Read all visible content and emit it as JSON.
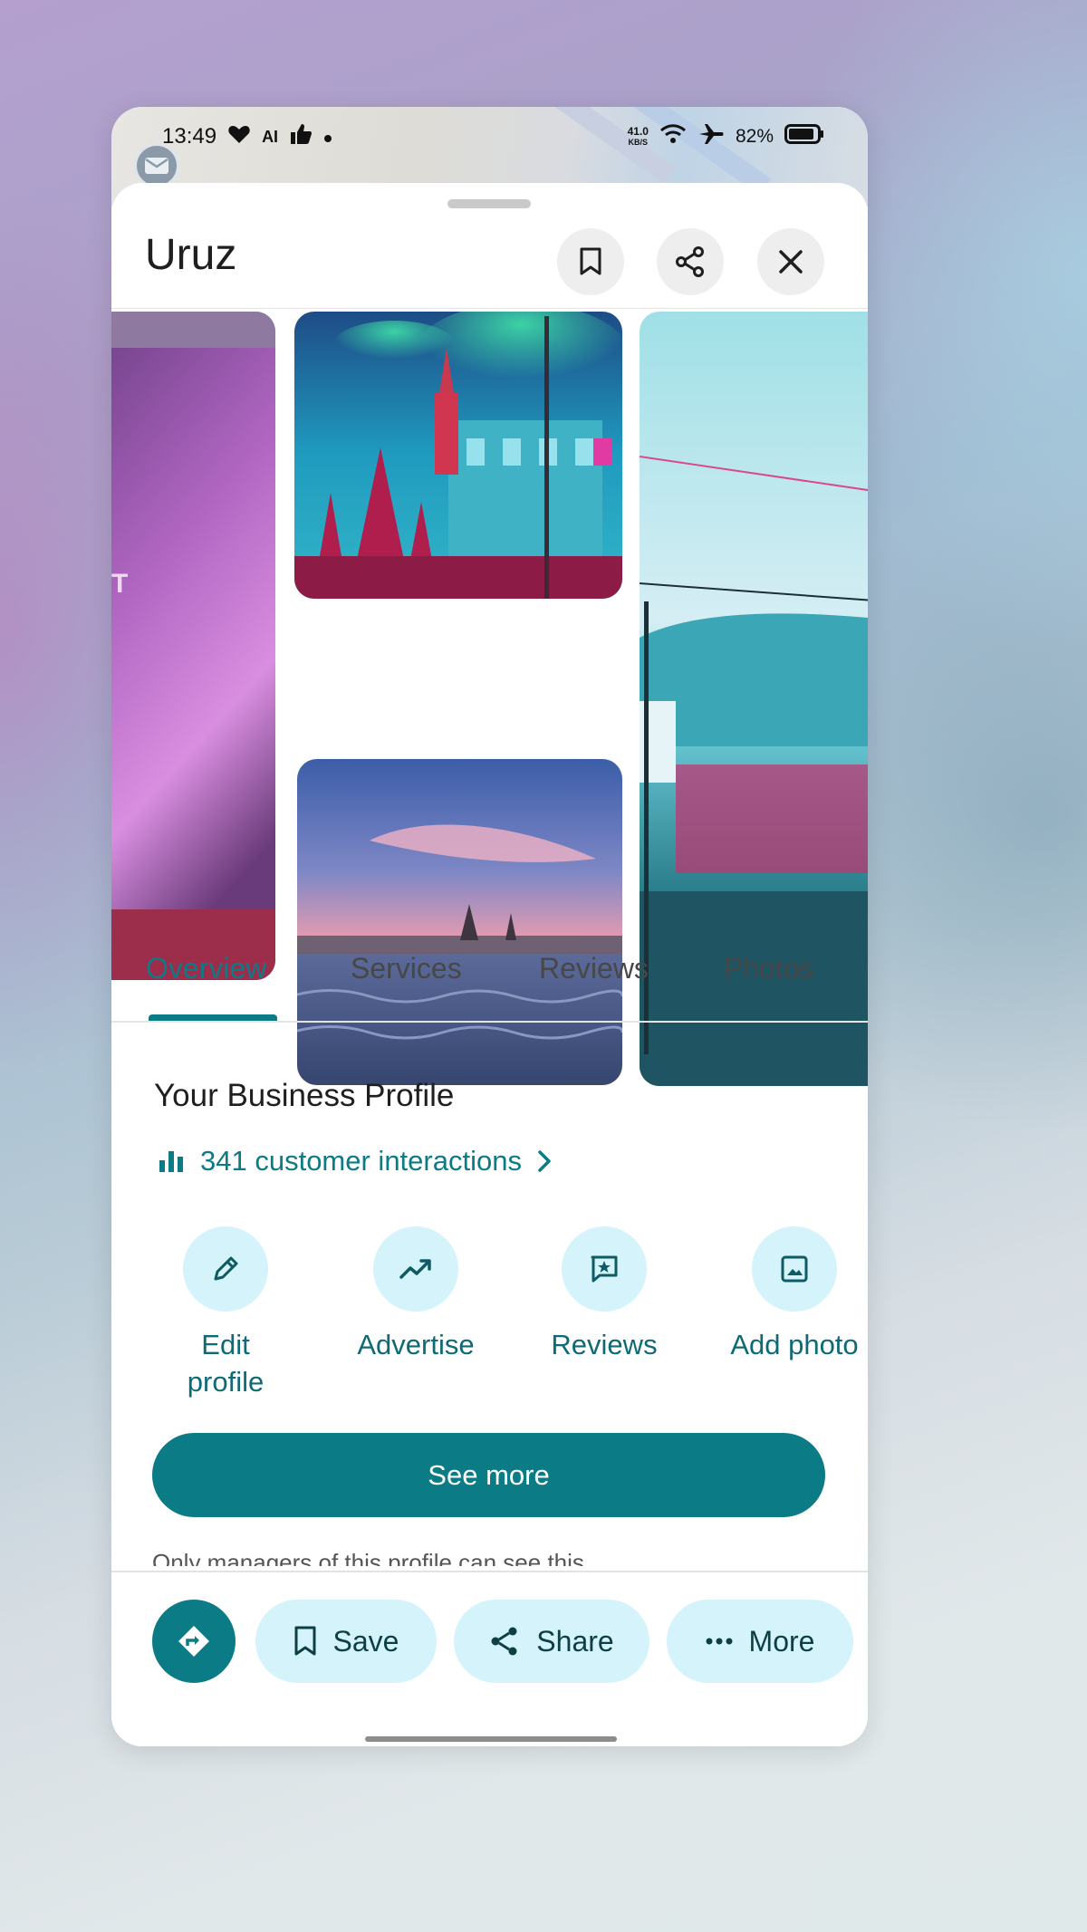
{
  "status_bar": {
    "time": "13:49",
    "ai_badge": "AI",
    "net_speed_value": "41.0",
    "net_speed_unit": "KB/S",
    "battery": "82%"
  },
  "place": {
    "name": "Uruz"
  },
  "header_actions": [
    {
      "icon": "bookmark-icon"
    },
    {
      "icon": "share-icon"
    },
    {
      "icon": "close-icon"
    }
  ],
  "tabs": [
    {
      "label": "Overview",
      "active": true
    },
    {
      "label": "Services",
      "active": false
    },
    {
      "label": "Reviews",
      "active": false
    },
    {
      "label": "Photos",
      "active": false
    }
  ],
  "business_profile": {
    "title": "Your Business Profile",
    "interactions_label": "341 customer interactions",
    "actions": [
      {
        "label": "Edit profile",
        "icon": "pencil-icon"
      },
      {
        "label": "Advertise",
        "icon": "trending-up-icon"
      },
      {
        "label": "Reviews",
        "icon": "star-comment-icon"
      },
      {
        "label": "Add photo",
        "icon": "image-icon"
      }
    ],
    "see_more_label": "See more",
    "managers_note": "Only managers of this profile can see this"
  },
  "bottom_actions": {
    "save_label": "Save",
    "share_label": "Share",
    "more_label": "More"
  },
  "colors": {
    "accent": "#0b7b86",
    "accent_light": "#d4f3fb"
  }
}
